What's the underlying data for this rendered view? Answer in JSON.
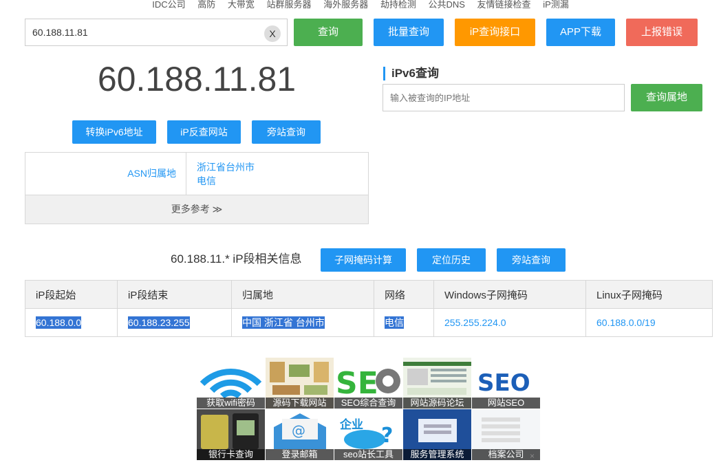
{
  "topnav": [
    "IDC公司",
    "高防",
    "大带宽",
    "站群服务器",
    "海外服务器",
    "劫持检测",
    "公共DNS",
    "友情链接检查",
    "iP测漏"
  ],
  "search": {
    "value": "60.188.11.81",
    "clear": "X"
  },
  "buttons": {
    "query": "查询",
    "batch": "批量查询",
    "api": "iP查询接口",
    "app": "APP下载",
    "report": "上报错误"
  },
  "main": {
    "ip": "60.188.11.81",
    "actions": [
      "转换iPv6地址",
      "iP反查网站",
      "旁站查询"
    ]
  },
  "info": {
    "label": "ASN归属地",
    "line1": "浙江省台州市",
    "line2": "电信",
    "more": "更多参考 ≫"
  },
  "ipv6": {
    "title": "iPv6查询",
    "placeholder": "输入被查询的IP地址",
    "button": "查询属地"
  },
  "segment": {
    "title": "60.188.11.* iP段相关信息",
    "actions": [
      "子网掩码计算",
      "定位历史",
      "旁站查询"
    ],
    "headers": [
      "iP段起始",
      "iP段结束",
      "归属地",
      "网络",
      "Windows子网掩码",
      "Linux子网掩码"
    ],
    "row": [
      "60.188.0.0",
      "60.188.23.255",
      "中国 浙江省 台州市",
      "电信",
      "255.255.224.0",
      "60.188.0.0/19"
    ]
  },
  "ads": [
    "获取wifi密码",
    "源码下载网站",
    "SEO综合查询",
    "网站源码论坛",
    "网站SEO",
    "银行卡查询",
    "登录邮箱",
    "seo站长工具",
    "服务管理系统",
    "档案公司"
  ],
  "ads_close": "×",
  "colors": {
    "green": "#4caf50",
    "blue": "#2196f3",
    "orange": "#ff9800",
    "red": "#f06a5a"
  }
}
